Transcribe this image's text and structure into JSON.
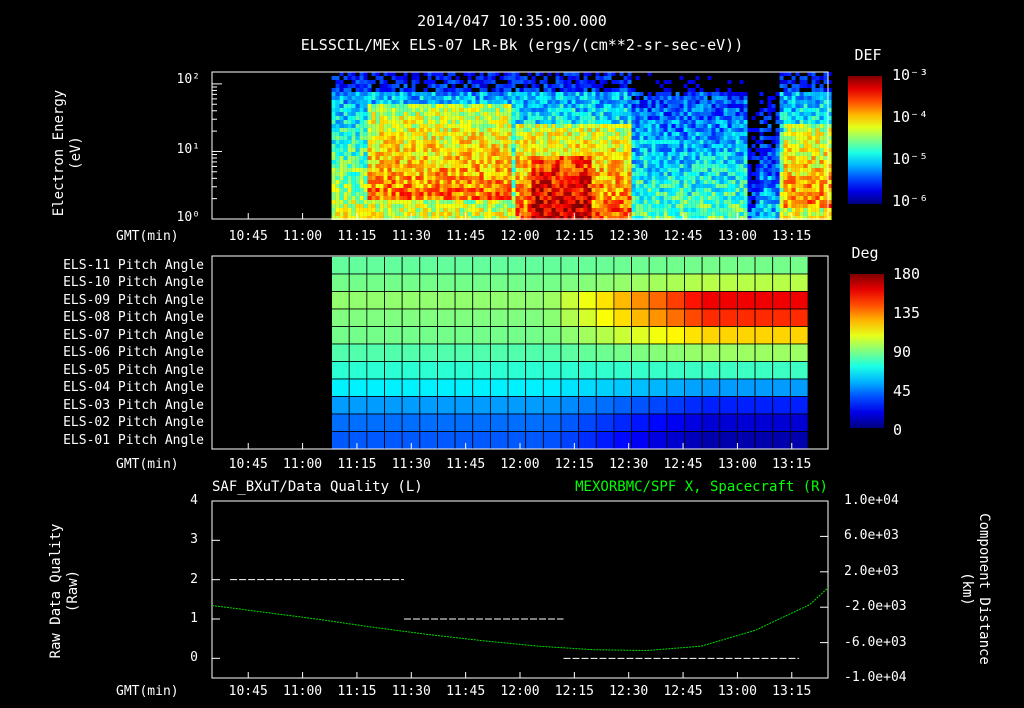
{
  "header": {
    "timestamp": "2014/047 10:35:00.000",
    "panel1_title": "ELSSCIL/MEx ELS-07 LR-Bk  (ergs/(cm**2-sr-sec-eV))"
  },
  "time_axis": {
    "label": "GMT(min)",
    "ticks": [
      "10:45",
      "11:00",
      "11:15",
      "11:30",
      "11:45",
      "12:00",
      "12:15",
      "12:30",
      "12:45",
      "13:00",
      "13:15"
    ]
  },
  "chart_data": [
    {
      "type": "heatmap",
      "name": "spectrogram",
      "ylabel": [
        "Electron Energy",
        "(eV)"
      ],
      "yscale": "log",
      "ylim": [
        1,
        150
      ],
      "y_ticks": [
        "10²",
        "10¹",
        "10⁰"
      ],
      "x_ticks": [
        "10:45",
        "11:00",
        "11:15",
        "11:30",
        "11:45",
        "12:00",
        "12:15",
        "12:30",
        "12:45",
        "13:00",
        "13:15"
      ],
      "data_start_time": "11:08",
      "colorbar": {
        "title": "DEF",
        "labels": [
          "10⁻³",
          "10⁻⁴",
          "10⁻⁵",
          "10⁻⁶"
        ],
        "scale": "log",
        "range": [
          1e-06,
          0.001
        ]
      }
    },
    {
      "type": "heatmap",
      "name": "pitch-angle",
      "rows": [
        "ELS-11 Pitch Angle",
        "ELS-10 Pitch Angle",
        "ELS-09 Pitch Angle",
        "ELS-08 Pitch Angle",
        "ELS-07 Pitch Angle",
        "ELS-06 Pitch Angle",
        "ELS-05 Pitch Angle",
        "ELS-04 Pitch Angle",
        "ELS-03 Pitch Angle",
        "ELS-02 Pitch Angle",
        "ELS-01 Pitch Angle"
      ],
      "x_ticks": [
        "10:45",
        "11:00",
        "11:15",
        "11:30",
        "11:45",
        "12:00",
        "12:15",
        "12:30",
        "12:45",
        "13:00",
        "13:15"
      ],
      "data_start_time": "11:08",
      "row_start_deg": [
        85,
        88,
        93,
        90,
        88,
        82,
        75,
        65,
        50,
        42,
        38
      ],
      "row_end_deg": [
        88,
        100,
        160,
        150,
        120,
        95,
        78,
        50,
        28,
        15,
        8
      ],
      "colorbar": {
        "title": "Deg",
        "labels": [
          "180",
          "135",
          "90",
          "45",
          "0"
        ],
        "range": [
          0,
          180
        ]
      }
    },
    {
      "type": "line",
      "name": "data-quality",
      "title_left": "SAF_BXuT/Data Quality (L)",
      "title_right": "MEXORBMC/SPF X, Spacecraft (R)",
      "ylabel_left": [
        "Raw Data Quality",
        "(Raw)"
      ],
      "ylabel_right": [
        "Component Distance",
        "(km)"
      ],
      "ylim_left": [
        -0.5,
        4
      ],
      "left_ticks": [
        "4",
        "3",
        "2",
        "1",
        "0"
      ],
      "right_ticks": [
        "1.0e+04",
        "6.0e+03",
        "2.0e+03",
        "-2.0e+03",
        "-6.0e+03",
        "-1.0e+04"
      ],
      "ylim_right": [
        -10000,
        10000
      ],
      "x_ticks": [
        "10:45",
        "11:00",
        "11:15",
        "11:30",
        "11:45",
        "12:00",
        "12:15",
        "12:30",
        "12:45",
        "13:00",
        "13:15"
      ],
      "series": [
        {
          "axis": "left",
          "color": "#ffffff",
          "segments": [
            {
              "x": [
                "10:40",
                "11:28"
              ],
              "y": 2
            },
            {
              "x": [
                "11:28",
                "12:12"
              ],
              "y": 1
            },
            {
              "x": [
                "12:12",
                "13:17"
              ],
              "y": 0
            }
          ]
        },
        {
          "axis": "right",
          "color": "#00dd00",
          "x": [
            "10:35",
            "10:50",
            "11:05",
            "11:20",
            "11:35",
            "11:50",
            "12:05",
            "12:20",
            "12:35",
            "12:50",
            "13:05",
            "13:20",
            "13:25"
          ],
          "y": [
            -1800,
            -2600,
            -3400,
            -4300,
            -5100,
            -5800,
            -6400,
            -6800,
            -6900,
            -6400,
            -4600,
            -1700,
            200
          ]
        }
      ]
    }
  ]
}
